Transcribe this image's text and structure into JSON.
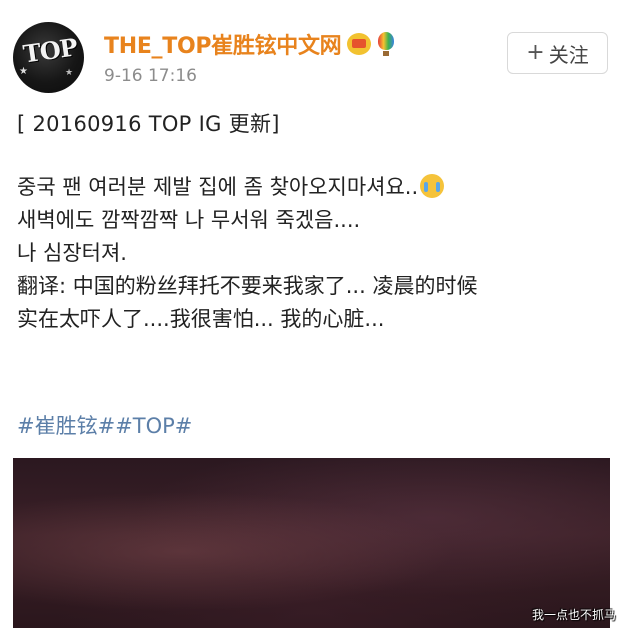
{
  "user": {
    "name": "THE_TOP崔胜铉中文网",
    "avatar_text": "TOP",
    "timestamp": "9-16 17:16",
    "badges": [
      "crown-badge-icon",
      "hot-air-balloon-icon"
    ]
  },
  "follow_button": {
    "icon": "+",
    "label": "关注"
  },
  "post": {
    "title": "[ 20160916 TOP IG 更新]",
    "korean_1": "중국 팬 여러분 제발 집에 좀 찾아오지마셔요..",
    "korean_2": "새벽에도 깜짝깜짝 나 무서워 죽겠음....",
    "korean_3": "나 심장터져.",
    "translation_1": "翻译: 中国的粉丝拜托不要来我家了... 凌晨的时候",
    "translation_2": "实在太吓人了....我很害怕... 我的心脏...",
    "hashtags": "#崔胜铉##TOP#"
  },
  "watermark": "我一点也不抓马",
  "colors": {
    "username": "#e8831d",
    "hashtag": "#5c7fa8",
    "timestamp": "#8c8c8c"
  }
}
